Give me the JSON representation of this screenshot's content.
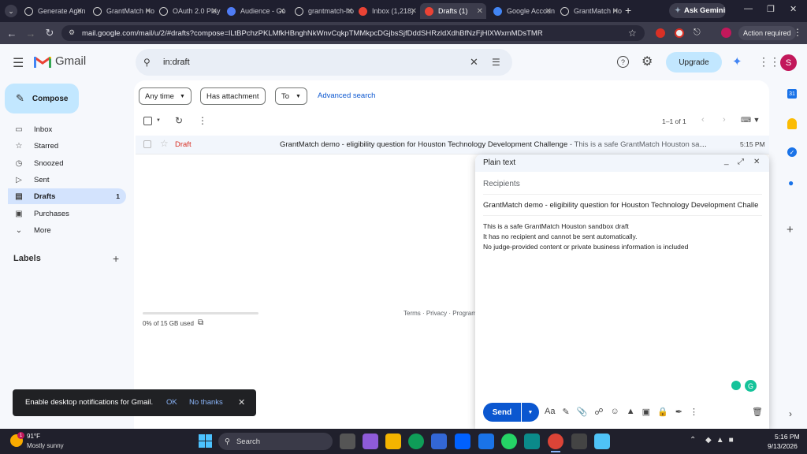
{
  "browser": {
    "tabs": [
      {
        "label": "Generate Agen",
        "icon": "openai-icon",
        "color": "#fff"
      },
      {
        "label": "GrantMatch Ho",
        "icon": "triangle-icon",
        "color": "#fff"
      },
      {
        "label": "OAuth 2.0 Play",
        "icon": "oauth-icon",
        "color": "#fff"
      },
      {
        "label": "Audience - Go",
        "icon": "shield-icon",
        "color": "#4f7cf5"
      },
      {
        "label": "grantmatch-ho",
        "icon": "triangle-icon",
        "color": "#fff"
      },
      {
        "label": "Inbox (1,218)",
        "icon": "gmail-icon",
        "color": "#ea4335"
      },
      {
        "label": "Drafts (1)",
        "icon": "gmail-icon",
        "color": "#ea4335"
      },
      {
        "label": "Google Accoun",
        "icon": "google-icon",
        "color": "#4285f4"
      },
      {
        "label": "GrantMatch Ho",
        "icon": "triangle-icon",
        "color": "#fff"
      }
    ],
    "ask_gemini": "Ask Gemini",
    "url": "mail.google.com/mail/u/2/#drafts?compose=lLtBPchzPKLMfkHBnghNkWnvCqkpTMMkpcDGjbsSjfDddSHRzldXdhBfNzFjHlXWxmMDsTMR",
    "action_required": "Action required"
  },
  "gmail": {
    "logo_text": "Gmail",
    "search_value": "in:draft",
    "upgrade_label": "Upgrade",
    "avatar_letter": "S",
    "compose_label": "Compose",
    "sidebar": [
      {
        "label": "Inbox",
        "icon": "inbox-icon",
        "count": ""
      },
      {
        "label": "Starred",
        "icon": "star-icon",
        "count": ""
      },
      {
        "label": "Snoozed",
        "icon": "clock-icon",
        "count": ""
      },
      {
        "label": "Sent",
        "icon": "send-icon",
        "count": ""
      },
      {
        "label": "Drafts",
        "icon": "draft-icon",
        "count": "1"
      },
      {
        "label": "Purchases",
        "icon": "bag-icon",
        "count": ""
      },
      {
        "label": "More",
        "icon": "chevron-down-icon",
        "count": ""
      }
    ],
    "labels_heading": "Labels",
    "filters": {
      "any_time": "Any time",
      "has_attachment": "Has attachment",
      "to": "To",
      "advanced": "Advanced search"
    },
    "pagination": "1–1 of 1",
    "row": {
      "tag": "Draft",
      "subject": "GrantMatch demo - eligibility question for Houston Technology Development Challenge",
      "snippet": " - This is a safe GrantMatch Houston san...",
      "time": "5:15 PM"
    },
    "footer": {
      "links": "Terms · Privacy · Program",
      "storage": "0% of 15 GB used",
      "storage_fraction": 0.0
    }
  },
  "compose": {
    "title": "Plain text",
    "recipients_placeholder": "Recipients",
    "subject": "GrantMatch demo - eligibility question for Houston Technology Development Challe",
    "body_lines": [
      "This is a safe GrantMatch Houston sandbox draft",
      "It has no recipient and cannot be sent automatically.",
      "No judge-provided content or private business information is included"
    ],
    "send_label": "Send"
  },
  "toast": {
    "message": "Enable desktop notifications for Gmail.",
    "ok": "OK",
    "no_thanks": "No thanks"
  },
  "taskbar": {
    "temp": "91°F",
    "weather": "Mostly sunny",
    "search": "Search",
    "time": "5:16 PM",
    "date": "9/13/2026",
    "weather_badge": "1"
  }
}
